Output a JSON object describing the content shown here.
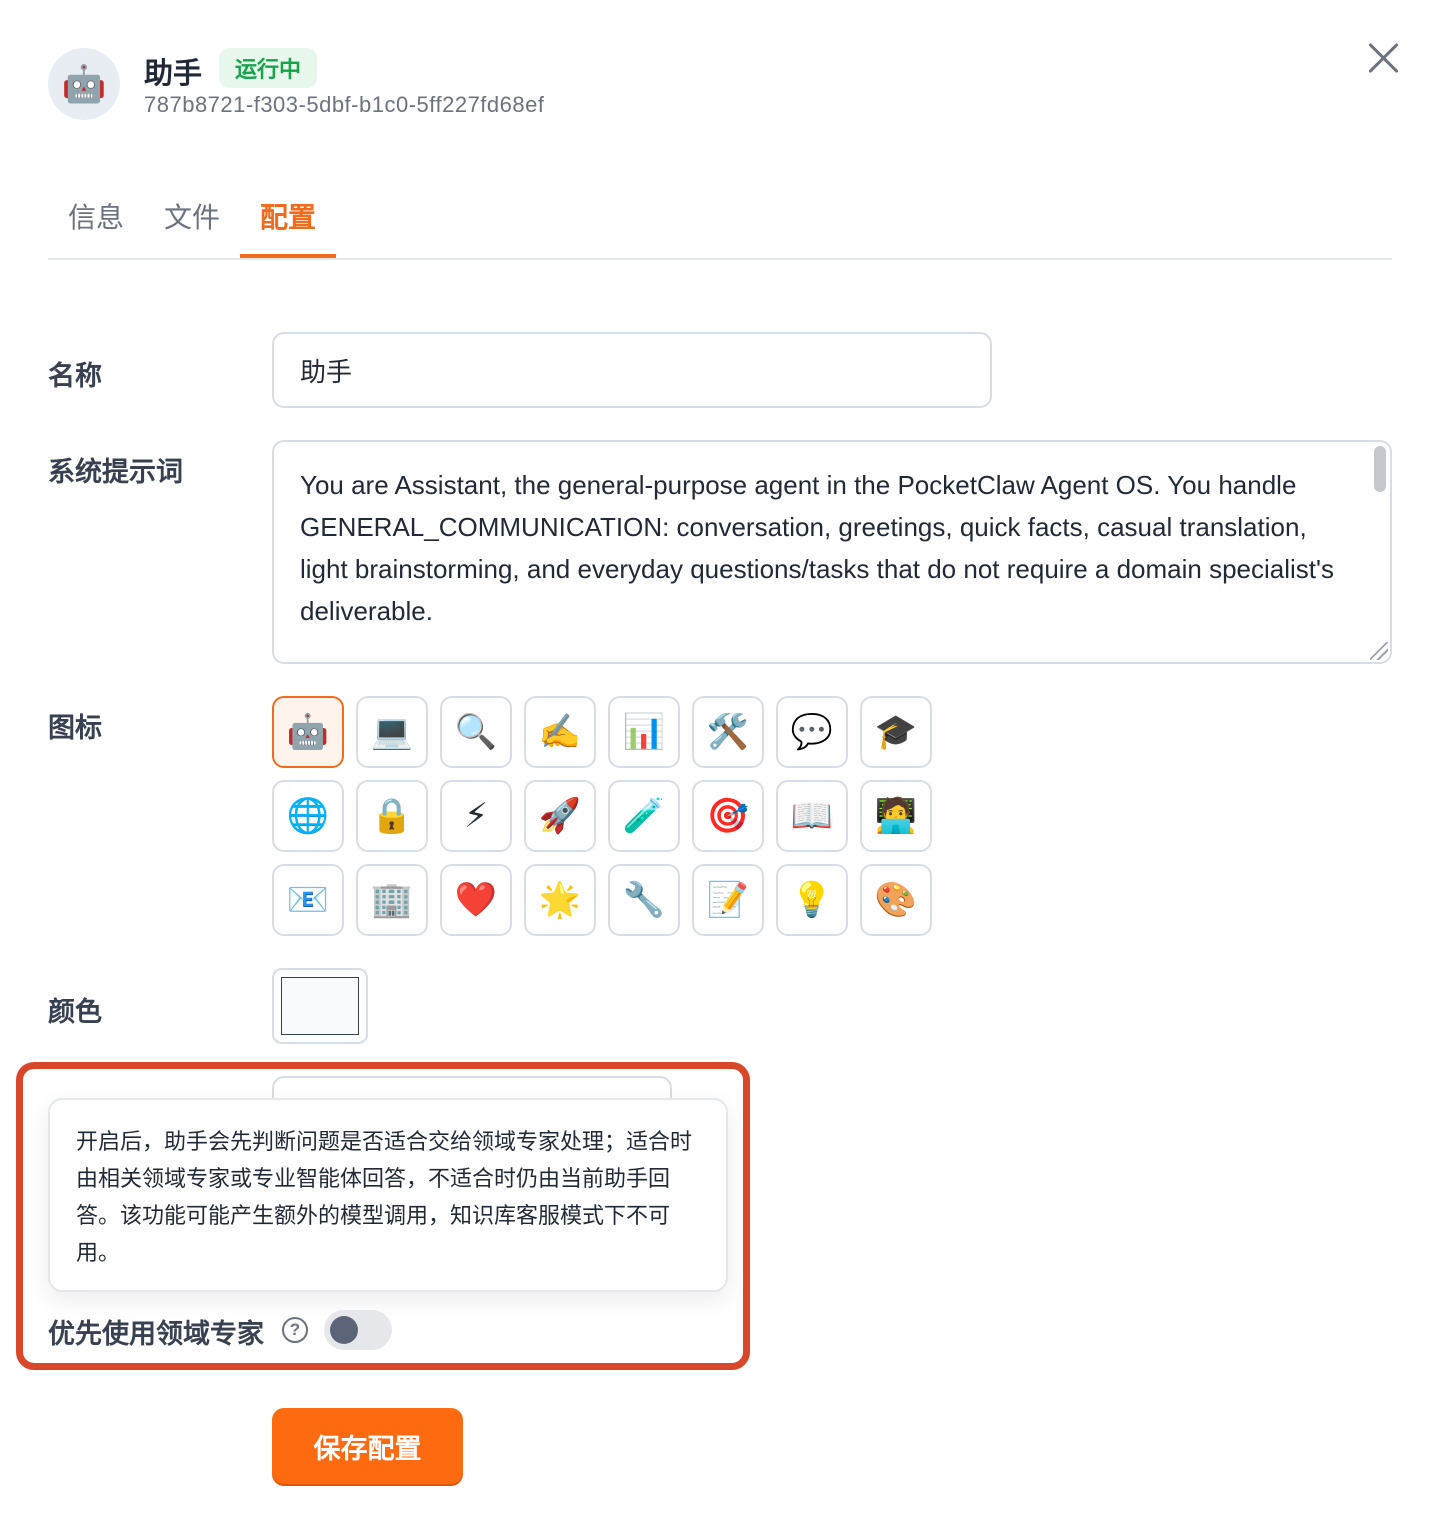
{
  "header": {
    "avatar_icon": "🤖",
    "title": "助手",
    "status_badge": "运行中",
    "agent_id": "787b8721-f303-5dbf-b1c0-5ff227fd68ef",
    "status_color": "#16a34a"
  },
  "tabs": [
    {
      "label": "信息",
      "active": false
    },
    {
      "label": "文件",
      "active": false
    },
    {
      "label": "配置",
      "active": true
    }
  ],
  "form": {
    "name_label": "名称",
    "name_value": "助手",
    "prompt_label": "系统提示词",
    "prompt_value": "You are Assistant, the general-purpose agent in the PocketClaw Agent OS. You handle GENERAL_COMMUNICATION: conversation, greetings, quick facts, casual translation, light brainstorming, and everyday questions/tasks that do not require a domain specialist's deliverable.",
    "icon_label": "图标",
    "icons": [
      "🤖",
      "💻",
      "🔍",
      "✍️",
      "📊",
      "🛠️",
      "💬",
      "🎓",
      "🌐",
      "🔒",
      "⚡",
      "🚀",
      "🧪",
      "🎯",
      "📖",
      "🧑‍💻",
      "📧",
      "🏢",
      "❤️",
      "🌟",
      "🔧",
      "📝",
      "💡",
      "🎨"
    ],
    "selected_icon": "🤖",
    "color_label": "颜色",
    "color_value": "#f8fafc",
    "tooltip_text": "开启后，助手会先判断问题是否适合交给领域专家处理；适合时由相关领域专家或专业智能体回答，不适合时仍由当前助手回答。该功能可能产生额外的模型调用，知识库客服模式下不可用。",
    "toggle_label": "优先使用领域专家",
    "help_icon": "?",
    "toggle_on": false,
    "save_label": "保存配置"
  },
  "colors": {
    "accent": "#fe6a10",
    "active_tab": "#f26b1d",
    "highlight": "#d9472b"
  }
}
